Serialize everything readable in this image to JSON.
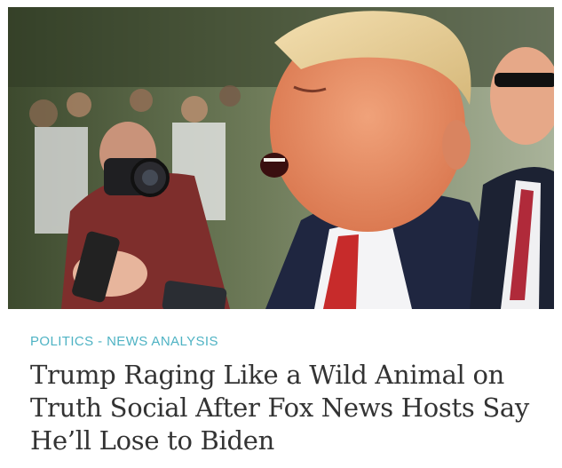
{
  "article": {
    "category": "POLITICS - NEWS ANALYSIS",
    "headline": "Trump Raging Like a Wild Animal on Truth Social After Fox News Hosts Say He’ll Lose to Biden"
  },
  "colors": {
    "category": "#4fb3c4",
    "headline": "#333333",
    "background": "#ffffff"
  }
}
